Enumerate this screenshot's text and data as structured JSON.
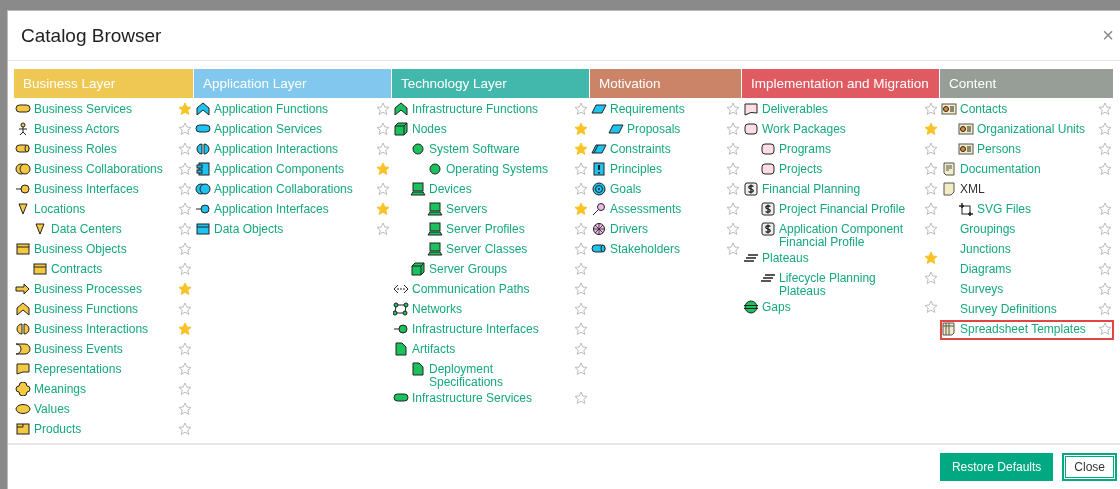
{
  "dialog": {
    "title": "Catalog Browser",
    "close": "×"
  },
  "layers": [
    {
      "title": "Business Layer",
      "color": "#eec853",
      "items": [
        {
          "label": "Business Services",
          "kind": "service",
          "starred": true
        },
        {
          "label": "Business Actors",
          "kind": "actor",
          "starred": false
        },
        {
          "label": "Business Roles",
          "kind": "role",
          "starred": false
        },
        {
          "label": "Business Collaborations",
          "kind": "collaboration",
          "starred": false
        },
        {
          "label": "Business Interfaces",
          "kind": "interface",
          "starred": false
        },
        {
          "label": "Locations",
          "kind": "location",
          "starred": false,
          "children": [
            {
              "label": "Data Centers",
              "kind": "location",
              "starred": false
            }
          ]
        },
        {
          "label": "Business Objects",
          "kind": "object",
          "starred": false,
          "children": [
            {
              "label": "Contracts",
              "kind": "object",
              "starred": false
            }
          ]
        },
        {
          "label": "Business Processes",
          "kind": "process",
          "starred": true
        },
        {
          "label": "Business Functions",
          "kind": "function",
          "starred": false
        },
        {
          "label": "Business Interactions",
          "kind": "interaction",
          "starred": true
        },
        {
          "label": "Business Events",
          "kind": "event",
          "starred": false
        },
        {
          "label": "Representations",
          "kind": "representation",
          "starred": false
        },
        {
          "label": "Meanings",
          "kind": "meaning",
          "starred": false
        },
        {
          "label": "Values",
          "kind": "value",
          "starred": false
        },
        {
          "label": "Products",
          "kind": "product",
          "starred": false
        }
      ]
    },
    {
      "title": "Application Layer",
      "color": "#82c8ee",
      "items": [
        {
          "label": "Application Functions",
          "kind": "function",
          "starred": false
        },
        {
          "label": "Application Services",
          "kind": "service",
          "starred": false
        },
        {
          "label": "Application Interactions",
          "kind": "interaction",
          "starred": false
        },
        {
          "label": "Application Components",
          "kind": "component",
          "starred": true
        },
        {
          "label": "Application Collaborations",
          "kind": "collaboration",
          "starred": false
        },
        {
          "label": "Application Interfaces",
          "kind": "interface",
          "starred": true
        },
        {
          "label": "Data Objects",
          "kind": "object",
          "starred": false
        }
      ]
    },
    {
      "title": "Technology Layer",
      "color": "#42b8ac",
      "items": [
        {
          "label": "Infrastructure Functions",
          "kind": "function",
          "starred": false
        },
        {
          "label": "Nodes",
          "kind": "node",
          "starred": true,
          "children": [
            {
              "label": "System Software",
              "kind": "system",
              "starred": true,
              "children": [
                {
                  "label": "Operating Systems",
                  "kind": "system",
                  "starred": false
                }
              ]
            },
            {
              "label": "Devices",
              "kind": "device",
              "starred": false,
              "children": [
                {
                  "label": "Servers",
                  "kind": "device",
                  "starred": true
                },
                {
                  "label": "Server Profiles",
                  "kind": "device",
                  "starred": false
                },
                {
                  "label": "Server Classes",
                  "kind": "device",
                  "starred": false
                }
              ]
            },
            {
              "label": "Server Groups",
              "kind": "node",
              "starred": false
            }
          ]
        },
        {
          "label": "Communication Paths",
          "kind": "path",
          "starred": false
        },
        {
          "label": "Networks",
          "kind": "network",
          "starred": false
        },
        {
          "label": "Infrastructure Interfaces",
          "kind": "interface",
          "starred": false
        },
        {
          "label": "Artifacts",
          "kind": "artifact",
          "starred": false,
          "children": [
            {
              "label": "Deployment Specifications",
              "kind": "artifact",
              "starred": false
            }
          ]
        },
        {
          "label": "Infrastructure Services",
          "kind": "service",
          "starred": false
        }
      ]
    },
    {
      "title": "Motivation",
      "color": "#cc8468",
      "items": [
        {
          "label": "Requirements",
          "kind": "requirement",
          "starred": false,
          "children": [
            {
              "label": "Proposals",
              "kind": "requirement",
              "starred": false
            }
          ]
        },
        {
          "label": "Constraints",
          "kind": "constraint",
          "starred": false
        },
        {
          "label": "Principles",
          "kind": "principle",
          "starred": false
        },
        {
          "label": "Goals",
          "kind": "goal",
          "starred": false
        },
        {
          "label": "Assessments",
          "kind": "assessment",
          "starred": false
        },
        {
          "label": "Drivers",
          "kind": "driver",
          "starred": false
        },
        {
          "label": "Stakeholders",
          "kind": "role",
          "starred": false
        }
      ]
    },
    {
      "title": "Implementation and Migration",
      "color": "#e05a62",
      "items": [
        {
          "label": "Deliverables",
          "kind": "deliverable",
          "starred": false
        },
        {
          "label": "Work Packages",
          "kind": "package",
          "starred": true,
          "children": [
            {
              "label": "Programs",
              "kind": "package",
              "starred": false
            },
            {
              "label": "Projects",
              "kind": "package",
              "starred": false
            }
          ]
        },
        {
          "label": "Financial Planning",
          "kind": "financial",
          "starred": false,
          "children": [
            {
              "label": "Project Financial Profile",
              "kind": "financial",
              "starred": false
            },
            {
              "label": "Application Component Financial Profile",
              "kind": "financial",
              "starred": false
            }
          ]
        },
        {
          "label": "Plateaus",
          "kind": "plateau",
          "starred": true,
          "children": [
            {
              "label": "Lifecycle Planning Plateaus",
              "kind": "plateau",
              "starred": false
            }
          ]
        },
        {
          "label": "Gaps",
          "kind": "gap",
          "starred": false
        }
      ]
    },
    {
      "title": "Content",
      "color": "#979d97",
      "items": [
        {
          "label": "Contacts",
          "kind": "contact",
          "starred": false,
          "children": [
            {
              "label": "Organizational Units",
              "kind": "contact",
              "starred": false
            },
            {
              "label": "Persons",
              "kind": "contact",
              "starred": false
            }
          ]
        },
        {
          "label": "Documentation",
          "kind": "document",
          "starred": false
        },
        {
          "label": "XML",
          "kind": "file",
          "link": false,
          "children": [
            {
              "label": "SVG Files",
              "kind": "svg",
              "starred": false
            }
          ]
        },
        {
          "label": "Groupings",
          "kind": "none",
          "starred": false
        },
        {
          "label": "Junctions",
          "kind": "none",
          "starred": false
        },
        {
          "label": "Diagrams",
          "kind": "none",
          "starred": false
        },
        {
          "label": "Surveys",
          "kind": "none",
          "starred": false
        },
        {
          "label": "Survey Definitions",
          "kind": "none",
          "starred": false
        },
        {
          "label": "Spreadsheet Templates",
          "kind": "spreadsheet",
          "starred": false,
          "highlighted": true
        }
      ]
    }
  ],
  "buttons": [
    {
      "label": "Restore Defaults",
      "primary": true
    },
    {
      "label": "Close",
      "primary": false
    }
  ]
}
